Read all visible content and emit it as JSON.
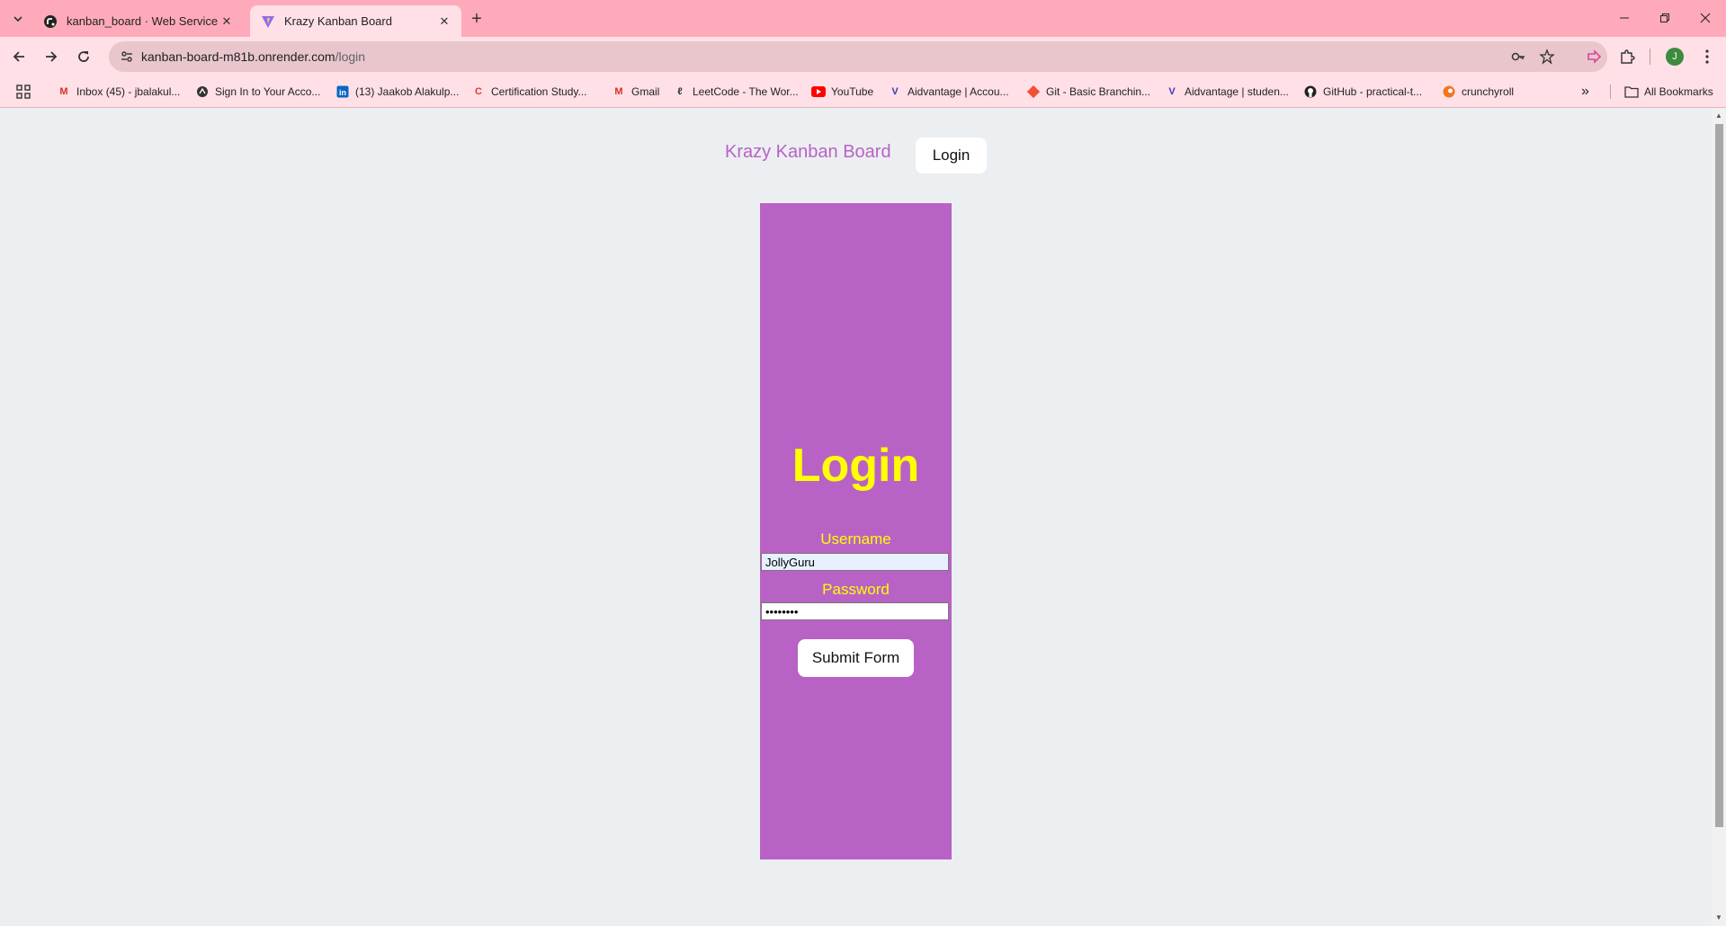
{
  "browser": {
    "tabs": [
      {
        "title": "kanban_board · Web Service ·",
        "icon": "render-icon",
        "active": false
      },
      {
        "title": "Krazy Kanban Board",
        "icon": "vite-icon",
        "active": true
      }
    ],
    "url_host": "kanban-board-m81b.onrender.com",
    "url_path": "/login",
    "profile_initial": "J",
    "bookmarks": [
      {
        "label": "Inbox (45) - jbalakul...",
        "icon": "gmail-icon"
      },
      {
        "label": "Sign In to Your Acco...",
        "icon": "globe-icon"
      },
      {
        "label": "(13) Jaakob Alakulp...",
        "icon": "linkedin-icon"
      },
      {
        "label": "Certification Study...",
        "icon": "coursera-icon"
      },
      {
        "label": "Gmail",
        "icon": "gmail-icon"
      },
      {
        "label": "LeetCode - The Wor...",
        "icon": "leetcode-icon"
      },
      {
        "label": "YouTube",
        "icon": "youtube-icon"
      },
      {
        "label": "Aidvantage | Accou...",
        "icon": "aidvantage-icon"
      },
      {
        "label": "Git - Basic Branchin...",
        "icon": "git-icon"
      },
      {
        "label": "Aidvantage | studen...",
        "icon": "aidvantage-icon"
      },
      {
        "label": "GitHub - practical-t...",
        "icon": "github-icon"
      },
      {
        "label": "crunchyroll",
        "icon": "crunchyroll-icon"
      }
    ],
    "all_bookmarks_label": "All Bookmarks",
    "colors": {
      "tabstrip": "#ffaabb",
      "toolbar": "#ffe0e7"
    }
  },
  "app": {
    "brand": "Krazy Kanban Board",
    "nav_login_label": "Login",
    "login_heading": "Login",
    "username_label": "Username",
    "username_value": "JollyGuru",
    "password_label": "Password",
    "password_value": "••••••••",
    "submit_label": "Submit Form",
    "colors": {
      "card": "#b962c5",
      "heading": "#ffff00",
      "background": "#eceff1"
    }
  }
}
